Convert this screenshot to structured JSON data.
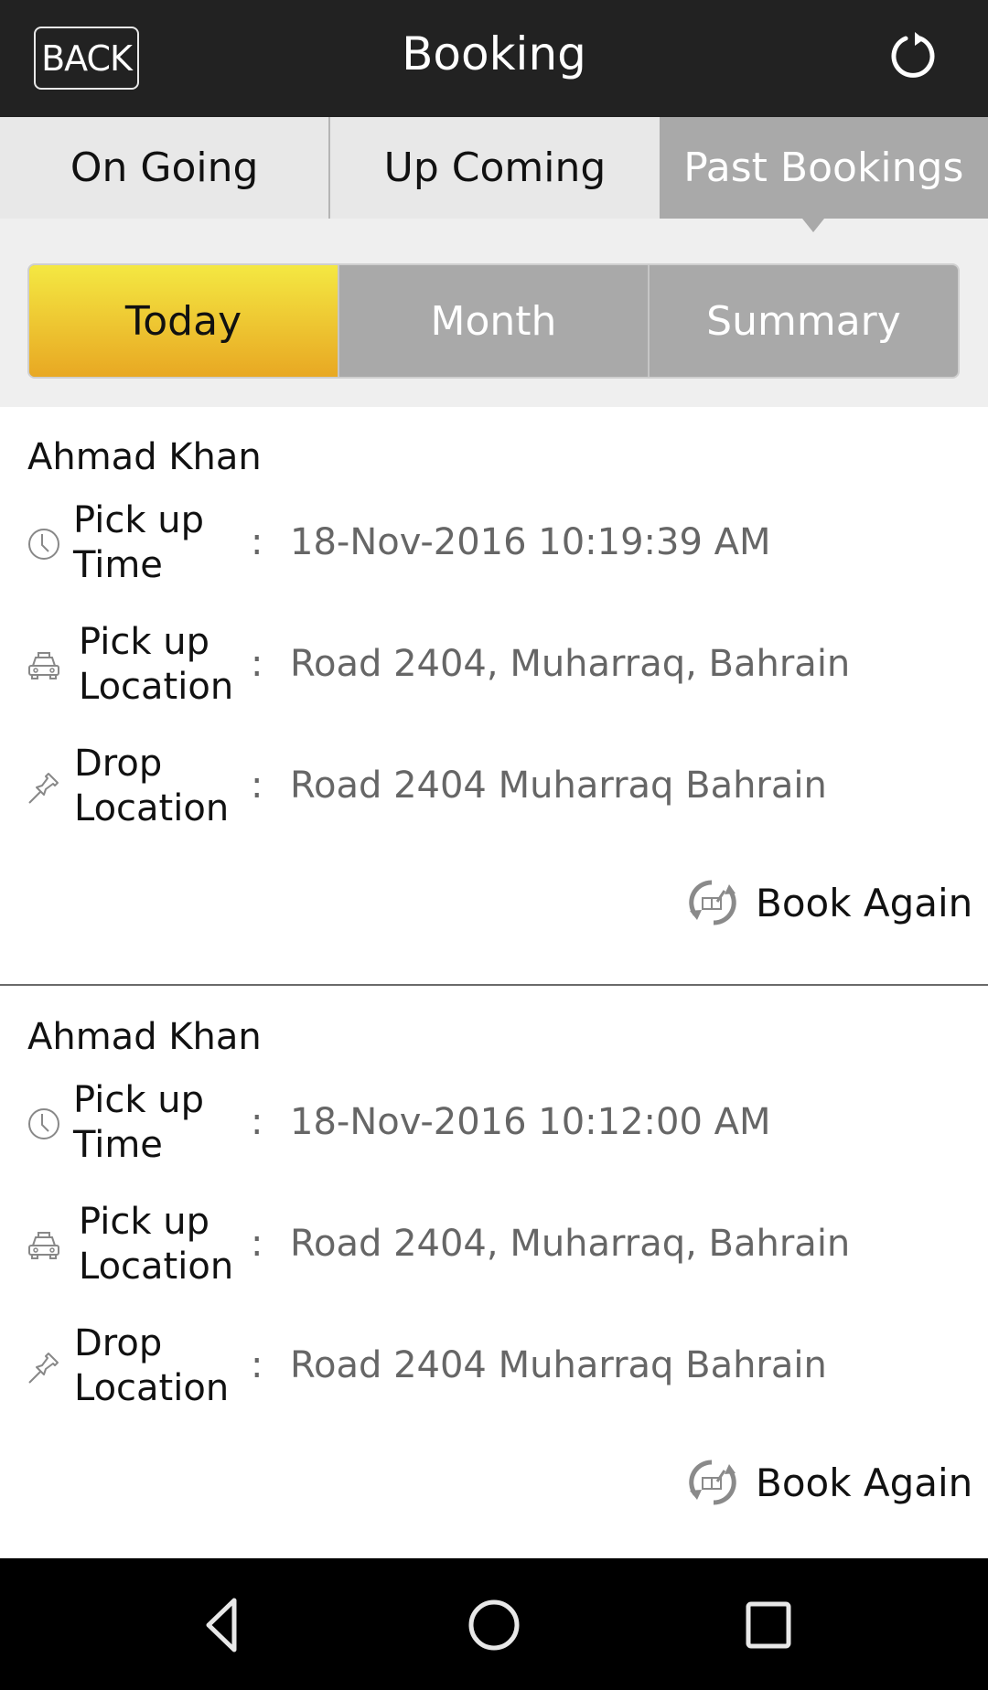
{
  "header": {
    "back_label": "BACK",
    "title": "Booking",
    "refresh_icon": "refresh-icon"
  },
  "tabs": [
    {
      "label": "On Going",
      "active": false
    },
    {
      "label": "Up Coming",
      "active": false
    },
    {
      "label": "Past Bookings",
      "active": true
    }
  ],
  "filters": [
    {
      "label": "Today",
      "active": true
    },
    {
      "label": "Month",
      "active": false
    },
    {
      "label": "Summary",
      "active": false
    }
  ],
  "colors": {
    "header_bg": "#222222",
    "active_tab_bg": "#a9a9a9",
    "active_filter_gradient": [
      "#f4e842",
      "#e8a823"
    ]
  },
  "bookings": [
    {
      "name": "Ahmad Khan",
      "pickup_time_label": "Pick up Time",
      "pickup_time": "18-Nov-2016 10:19:39 AM",
      "pickup_location_label": "Pick up Location",
      "pickup_location": "Road 2404, Muharraq, Bahrain",
      "drop_location_label": "Drop Location",
      "drop_location": "Road 2404 Muharraq Bahrain",
      "separator": ":",
      "book_again_label": "Book Again"
    },
    {
      "name": "Ahmad Khan",
      "pickup_time_label": "Pick up Time",
      "pickup_time": "18-Nov-2016 10:12:00 AM",
      "pickup_location_label": "Pick up Location",
      "pickup_location": "Road 2404, Muharraq, Bahrain",
      "drop_location_label": "Drop Location",
      "drop_location": "Road 2404 Muharraq Bahrain",
      "separator": ":",
      "book_again_label": "Book Again"
    }
  ],
  "system_nav": {
    "icons": [
      "back-icon",
      "home-icon",
      "recents-icon"
    ]
  }
}
